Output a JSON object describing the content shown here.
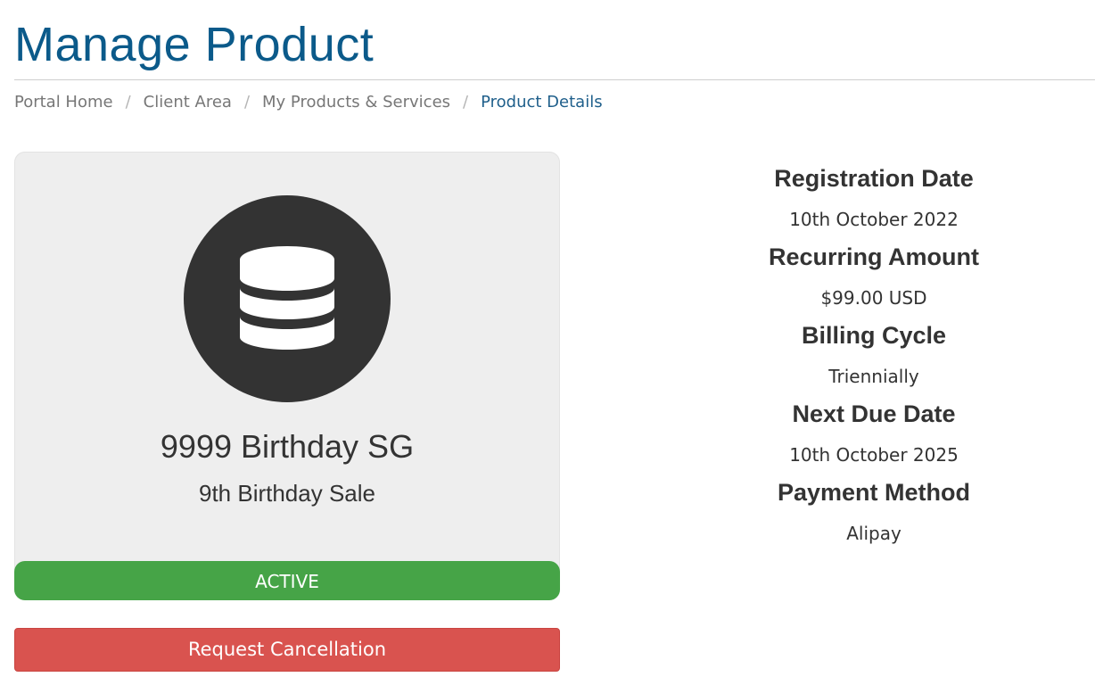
{
  "header": {
    "title": "Manage Product"
  },
  "breadcrumb": [
    {
      "label": "Portal Home",
      "separator": "/"
    },
    {
      "label": "Client Area",
      "separator": "/"
    },
    {
      "label": "My Products & Services",
      "separator": "/"
    },
    {
      "label": "Product Details"
    }
  ],
  "product": {
    "icon": "database-icon",
    "name": "9999 Birthday SG",
    "group": "9th Birthday Sale",
    "status": "ACTIVE",
    "status_color": "#46a447"
  },
  "actions": {
    "cancel_label": "Request Cancellation",
    "cancel_color": "#d9534f"
  },
  "details": [
    {
      "label": "Registration Date",
      "value": "10th October 2022"
    },
    {
      "label": "Recurring Amount",
      "value": "$99.00 USD"
    },
    {
      "label": "Billing Cycle",
      "value": "Triennially"
    },
    {
      "label": "Next Due Date",
      "value": "10th October 2025"
    },
    {
      "label": "Payment Method",
      "value": "Alipay"
    }
  ],
  "colors": {
    "accent": "#0b5a8a",
    "card_background": "#eeeeee"
  }
}
